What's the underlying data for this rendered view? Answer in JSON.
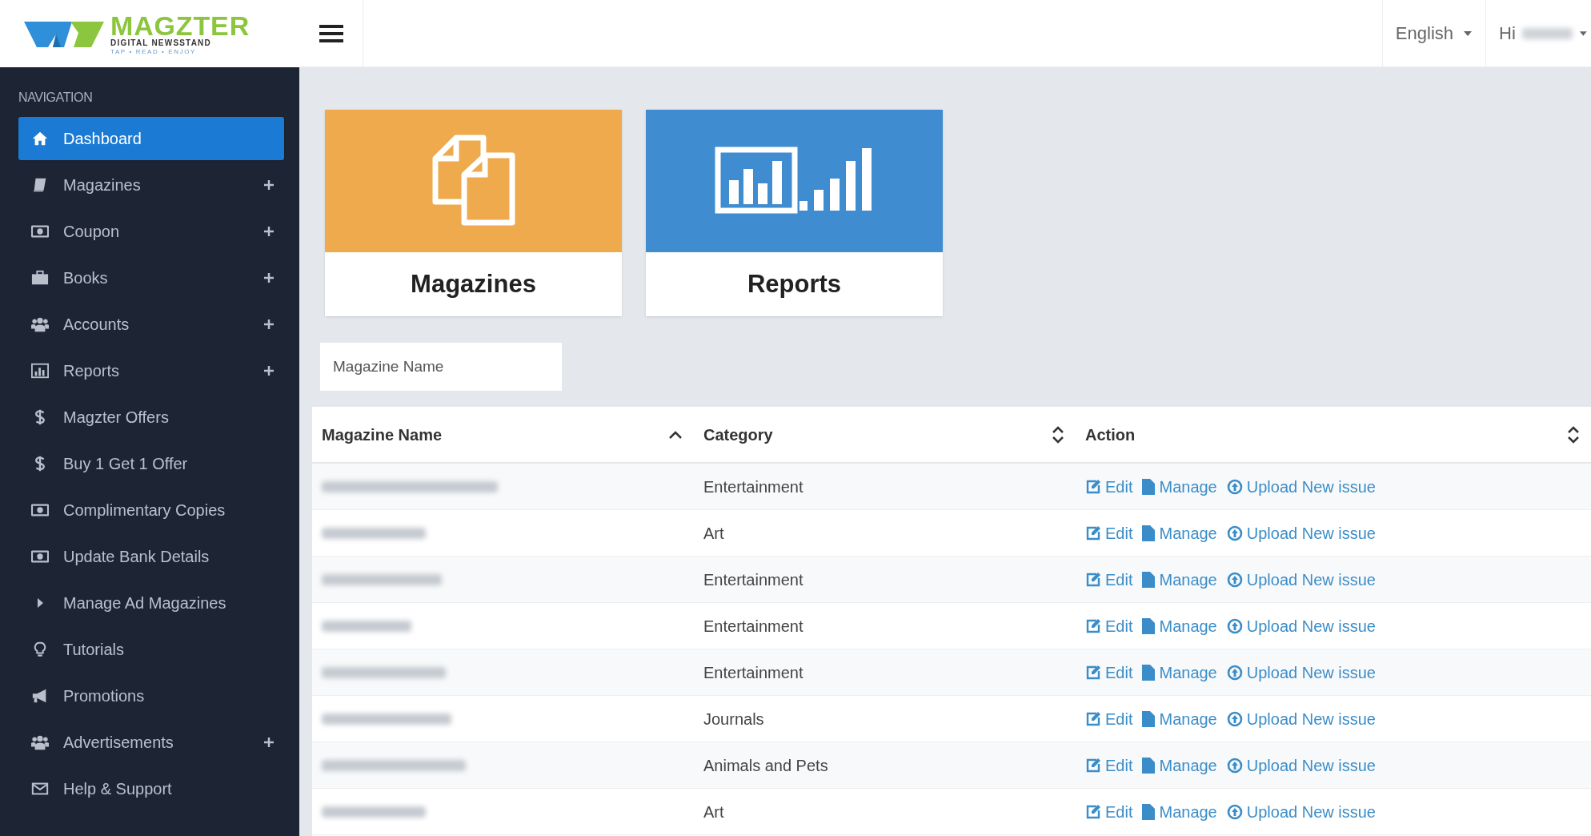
{
  "logo": {
    "name": "MAGZTER",
    "tagline": "DIGITAL NEWSSTAND",
    "motto": "TAP • READ • ENJOY"
  },
  "header": {
    "language": "English",
    "greeting": "Hi"
  },
  "sidebar": {
    "heading": "NAVIGATION",
    "items": [
      {
        "label": "Dashboard",
        "kind": "home",
        "selected": true,
        "expandable": false
      },
      {
        "label": "Magazines",
        "kind": "book",
        "selected": false,
        "expandable": true
      },
      {
        "label": "Coupon",
        "kind": "money",
        "selected": false,
        "expandable": true
      },
      {
        "label": "Books",
        "kind": "briefcase",
        "selected": false,
        "expandable": true
      },
      {
        "label": "Accounts",
        "kind": "users",
        "selected": false,
        "expandable": true
      },
      {
        "label": "Reports",
        "kind": "chart",
        "selected": false,
        "expandable": true
      },
      {
        "label": "Magzter Offers",
        "kind": "dollar",
        "selected": false,
        "expandable": false
      },
      {
        "label": "Buy 1 Get 1 Offer",
        "kind": "dollar",
        "selected": false,
        "expandable": false
      },
      {
        "label": "Complimentary Copies",
        "kind": "money",
        "selected": false,
        "expandable": false
      },
      {
        "label": "Update Bank Details",
        "kind": "money",
        "selected": false,
        "expandable": false
      },
      {
        "label": "Manage Ad Magazines",
        "kind": "caret",
        "selected": false,
        "expandable": false
      },
      {
        "label": "Tutorials",
        "kind": "bulb",
        "selected": false,
        "expandable": false
      },
      {
        "label": "Promotions",
        "kind": "megaphone",
        "selected": false,
        "expandable": false
      },
      {
        "label": "Advertisements",
        "kind": "users",
        "selected": false,
        "expandable": true
      },
      {
        "label": "Help & Support",
        "kind": "mail",
        "selected": false,
        "expandable": false
      }
    ]
  },
  "tiles": [
    {
      "label": "Magazines",
      "kind": "copies",
      "color": "#eeaa4c"
    },
    {
      "label": "Reports",
      "kind": "chart",
      "color": "#3f8dd0"
    }
  ],
  "search": {
    "placeholder": "Magazine Name"
  },
  "table": {
    "columns": [
      {
        "label": "Magazine Name",
        "sorted": true
      },
      {
        "label": "Category",
        "sorted": false
      },
      {
        "label": "Action",
        "sorted": false
      }
    ],
    "rows": [
      {
        "category": "Entertainment",
        "actions": [
          {
            "kind": "edit",
            "label": "Edit"
          },
          {
            "kind": "manage",
            "label": "Manage"
          },
          {
            "kind": "upload",
            "label": "Upload New issue"
          }
        ]
      },
      {
        "category": "Art",
        "actions": [
          {
            "kind": "edit",
            "label": "Edit"
          },
          {
            "kind": "manage",
            "label": "Manage"
          },
          {
            "kind": "upload",
            "label": "Upload New issue"
          }
        ]
      },
      {
        "category": "Entertainment",
        "actions": [
          {
            "kind": "edit",
            "label": "Edit"
          },
          {
            "kind": "manage",
            "label": "Manage"
          },
          {
            "kind": "upload",
            "label": "Upload New issue"
          }
        ]
      },
      {
        "category": "Entertainment",
        "actions": [
          {
            "kind": "edit",
            "label": "Edit"
          },
          {
            "kind": "manage",
            "label": "Manage"
          },
          {
            "kind": "upload",
            "label": "Upload New issue"
          }
        ]
      },
      {
        "category": "Entertainment",
        "actions": [
          {
            "kind": "edit",
            "label": "Edit"
          },
          {
            "kind": "manage",
            "label": "Manage"
          },
          {
            "kind": "upload",
            "label": "Upload New issue"
          }
        ]
      },
      {
        "category": "Journals",
        "actions": [
          {
            "kind": "edit",
            "label": "Edit"
          },
          {
            "kind": "manage",
            "label": "Manage"
          },
          {
            "kind": "upload",
            "label": "Upload New issue"
          }
        ]
      },
      {
        "category": "Animals and Pets",
        "actions": [
          {
            "kind": "edit",
            "label": "Edit"
          },
          {
            "kind": "manage",
            "label": "Manage"
          },
          {
            "kind": "upload",
            "label": "Upload New issue"
          }
        ]
      },
      {
        "category": "Art",
        "actions": [
          {
            "kind": "edit",
            "label": "Edit"
          },
          {
            "kind": "manage",
            "label": "Manage"
          },
          {
            "kind": "upload",
            "label": "Upload New issue"
          }
        ]
      }
    ]
  }
}
